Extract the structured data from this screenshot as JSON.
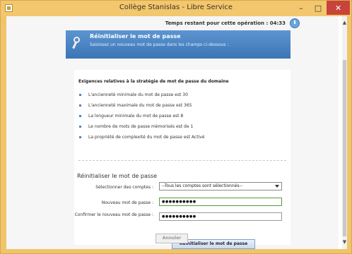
{
  "window": {
    "title": "Collège Stanislas - Libre Service",
    "minimize_glyph": "–",
    "maximize_glyph": "□",
    "close_glyph": "✕"
  },
  "timer": {
    "label": "Temps restant pour cette opération : 04:33",
    "icon": "clock-icon"
  },
  "banner": {
    "title": "Réinitialiser le mot de passe",
    "subtitle": "Saisissez un nouveau mot de passe dans les champs ci-dessous :",
    "icon": "key-icon"
  },
  "requirements": {
    "title": "Exigences relatives à la stratégie de mot de passe du domaine",
    "items": [
      "L'ancienneté minimale du mot de passe est 30",
      "L'ancienneté maximale du mot de passe est 365",
      "La longueur minimale du mot de passe est 8",
      "Le nombre de mots de passe mémorisés est de 1",
      "La propriété de complexité du mot de passe est Activé"
    ]
  },
  "form": {
    "title": "Réinitialiser le mot de passe",
    "accounts_label": "Sélectionner des comptes :",
    "accounts_value": "--Tous les comptes sont sélectionnés--",
    "new_password_label": "Nouveau mot de passe :",
    "new_password_value": "●●●●●●●●●●",
    "confirm_password_label": "Confirmer le nouveau mot de passe :",
    "confirm_password_value": "●●●●●●●●●●"
  },
  "buttons": {
    "reset_label": "Réinitialiser le mot de passe",
    "cancel_label": "Annuler"
  },
  "colors": {
    "titlebar": "#f2c76e",
    "banner": "#4a86c5",
    "close": "#c7443a"
  }
}
